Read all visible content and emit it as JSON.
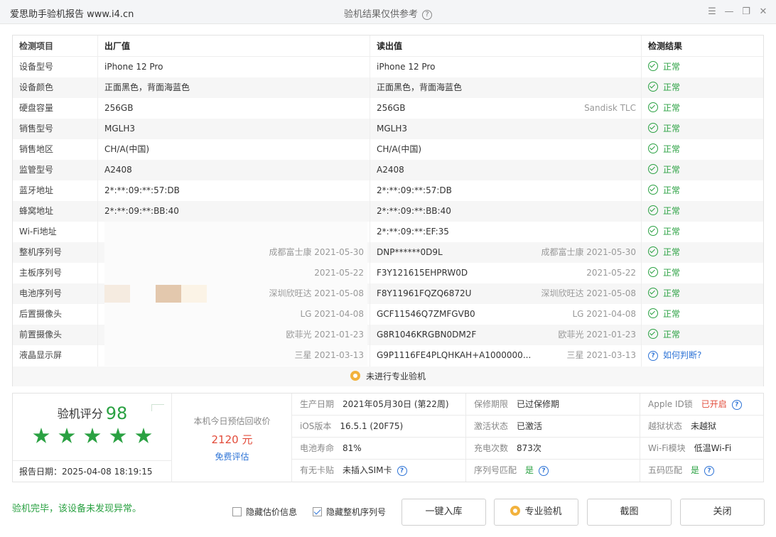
{
  "window": {
    "app_title": "爱思助手验机报告 www.i4.cn",
    "center_title": "验机结果仅供参考",
    "help_glyph": "?",
    "controls": [
      "☰",
      "—",
      "❐",
      "✕"
    ]
  },
  "table": {
    "headers": [
      "检测项目",
      "出厂值",
      "读出值",
      "检测结果"
    ],
    "rows": [
      {
        "item": "设备型号",
        "factory": "iPhone 12 Pro",
        "factory_note": "",
        "read": "iPhone 12 Pro",
        "read_note": "",
        "result": "正常",
        "status": "ok"
      },
      {
        "item": "设备颜色",
        "factory": "正面黑色，背面海蓝色",
        "factory_note": "",
        "read": "正面黑色，背面海蓝色",
        "read_note": "",
        "result": "正常",
        "status": "ok"
      },
      {
        "item": "硬盘容量",
        "factory": "256GB",
        "factory_note": "",
        "read": "256GB",
        "read_note": "Sandisk TLC",
        "result": "正常",
        "status": "ok"
      },
      {
        "item": "销售型号",
        "factory": "MGLH3",
        "factory_note": "",
        "read": "MGLH3",
        "read_note": "",
        "result": "正常",
        "status": "ok"
      },
      {
        "item": "销售地区",
        "factory": "CH/A(中国)",
        "factory_note": "",
        "read": "CH/A(中国)",
        "read_note": "",
        "result": "正常",
        "status": "ok"
      },
      {
        "item": "监管型号",
        "factory": "A2408",
        "factory_note": "",
        "read": "A2408",
        "read_note": "",
        "result": "正常",
        "status": "ok"
      },
      {
        "item": "蓝牙地址",
        "factory": "2*:**:09:**:57:DB",
        "factory_note": "",
        "read": "2*:**:09:**:57:DB",
        "read_note": "",
        "result": "正常",
        "status": "ok"
      },
      {
        "item": "蜂窝地址",
        "factory": "2*:**:09:**:BB:40",
        "factory_note": "",
        "read": "2*:**:09:**:BB:40",
        "read_note": "",
        "result": "正常",
        "status": "ok"
      },
      {
        "item": "Wi-Fi地址",
        "factory": "",
        "factory_note": "",
        "read": "2*:**:09:**:EF:35",
        "read_note": "",
        "result": "正常",
        "status": "ok"
      },
      {
        "item": "整机序列号",
        "factory": "",
        "factory_note": "成都富士康 2021-05-30",
        "read": "DNP******0D9L",
        "read_note": "成都富士康 2021-05-30",
        "result": "正常",
        "status": "ok"
      },
      {
        "item": "主板序列号",
        "factory": "",
        "factory_note": "2021-05-22",
        "read": "F3Y121615EHPRW0D",
        "read_note": "2021-05-22",
        "result": "正常",
        "status": "ok"
      },
      {
        "item": "电池序列号",
        "factory": "",
        "factory_note": "深圳欣旺达 2021-05-08",
        "read": "F8Y11961FQZQ6872U",
        "read_note": "深圳欣旺达 2021-05-08",
        "result": "正常",
        "status": "ok"
      },
      {
        "item": "后置摄像头",
        "factory": "",
        "factory_note": "LG 2021-04-08",
        "read": "GCF11546Q7ZMFGVB0",
        "read_note": "LG 2021-04-08",
        "result": "正常",
        "status": "ok"
      },
      {
        "item": "前置摄像头",
        "factory": "",
        "factory_note": "欧菲光 2021-01-23",
        "read": "G8R1046KRGBN0DM2F",
        "read_note": "欧菲光 2021-01-23",
        "result": "正常",
        "status": "ok"
      },
      {
        "item": "液晶显示屏",
        "factory": "",
        "factory_note": "三星 2021-03-13",
        "read": "G9P1116FE4PLQHKAH+A1000000...",
        "read_note": "三星 2021-03-13",
        "result": "如何判断?",
        "status": "query"
      }
    ],
    "pro_check_label": "未进行专业验机"
  },
  "summary": {
    "score_label": "验机评分",
    "score": "98",
    "stars": 5,
    "report_date_label": "报告日期：",
    "report_date": "2025-04-08 18:19:15",
    "estimate_label": "本机今日预估回收价",
    "estimate_value": "2120 元",
    "estimate_link": "免费评估",
    "grid": [
      [
        {
          "label": "生产日期",
          "value": "2021年05月30日 (第22周)",
          "tone": "normal",
          "help": false
        },
        {
          "label": "保修期限",
          "value": "已过保修期",
          "tone": "normal",
          "help": false
        },
        {
          "label": "Apple ID锁",
          "value": "已开启",
          "tone": "red",
          "help": true
        }
      ],
      [
        {
          "label": "iOS版本",
          "value": "16.5.1 (20F75)",
          "tone": "normal",
          "help": false
        },
        {
          "label": "激活状态",
          "value": "已激活",
          "tone": "normal",
          "help": false
        },
        {
          "label": "越狱状态",
          "value": "未越狱",
          "tone": "normal",
          "help": false
        }
      ],
      [
        {
          "label": "电池寿命",
          "value": "81%",
          "tone": "normal",
          "help": false
        },
        {
          "label": "充电次数",
          "value": "873次",
          "tone": "normal",
          "help": false
        },
        {
          "label": "Wi-Fi模块",
          "value": "低温Wi-Fi",
          "tone": "normal",
          "help": false
        }
      ],
      [
        {
          "label": "有无卡贴",
          "value": "未插入SIM卡",
          "tone": "normal",
          "help": true
        },
        {
          "label": "序列号匹配",
          "value": "是",
          "tone": "green",
          "help": true
        },
        {
          "label": "五码匹配",
          "value": "是",
          "tone": "green",
          "help": true
        }
      ]
    ]
  },
  "footer": {
    "done_message": "验机完毕，该设备未发现异常。",
    "checkbox_hide_price": {
      "label": "隐藏估价信息",
      "checked": false
    },
    "checkbox_hide_serial": {
      "label": "隐藏整机序列号",
      "checked": true
    },
    "buttons": {
      "import": "一键入库",
      "pro_check": "专业验机",
      "screenshot": "截图",
      "close": "关闭"
    }
  },
  "colors": {
    "ok_green": "#2aa142",
    "alert_red": "#e24b3a",
    "link_blue": "#2d73d6",
    "medal_gold": "#f2b23d"
  }
}
